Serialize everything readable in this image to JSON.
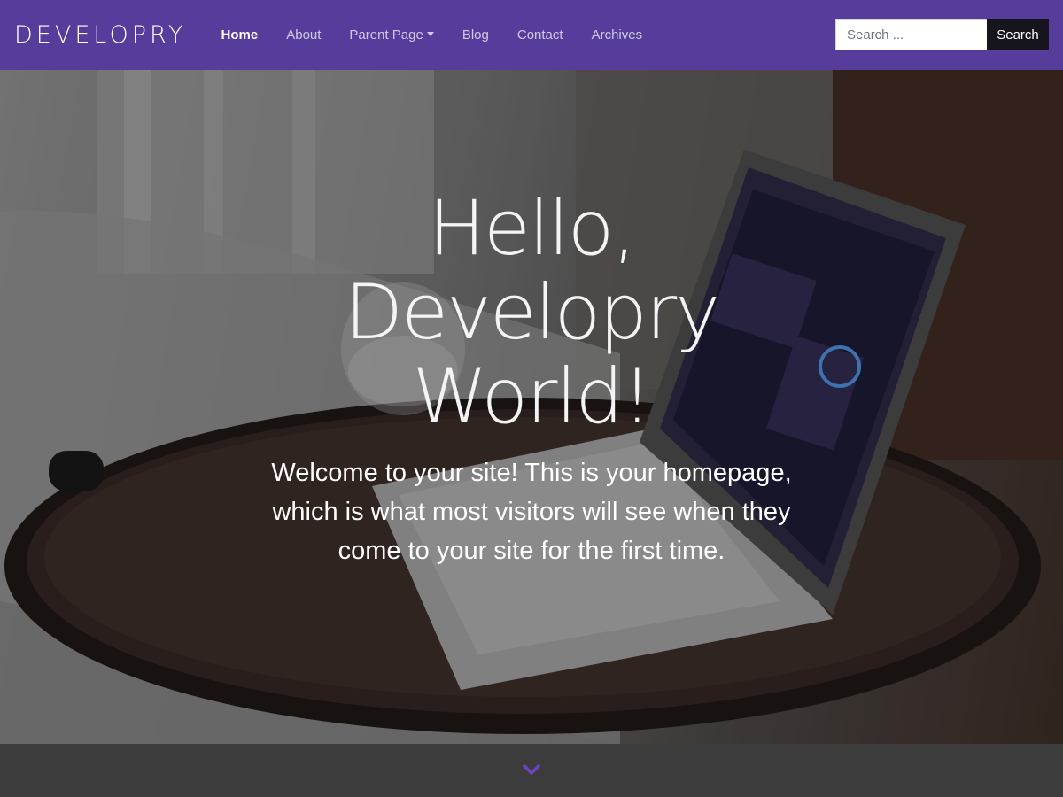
{
  "navbar": {
    "brand": "DEVELOPRY",
    "links": [
      {
        "label": "Home",
        "active": true
      },
      {
        "label": "About"
      },
      {
        "label": "Parent Page",
        "dropdown": true
      },
      {
        "label": "Blog"
      },
      {
        "label": "Contact"
      },
      {
        "label": "Archives"
      }
    ],
    "search": {
      "placeholder": "Search ...",
      "button_label": "Search"
    }
  },
  "hero": {
    "title": "Hello, Developry World!",
    "text": "Welcome to your site! This is your homepage, which is what most visitors will see when they come to your site for the first time."
  },
  "icons": {
    "scroll_down": "chevron-down-icon",
    "dropdown": "caret-down-icon"
  },
  "colors": {
    "brand_purple": "#563d9b",
    "search_button": "#16141c",
    "chevron": "#6f42c1"
  }
}
